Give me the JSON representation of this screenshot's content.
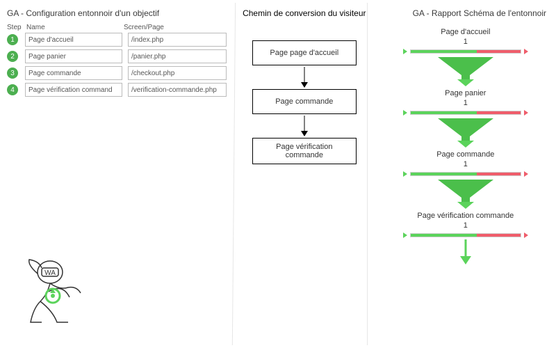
{
  "headings": {
    "left": "GA - Configuration entonnoir d'un objectif",
    "middle": "Chemin de conversion du visiteur",
    "right": "GA - Rapport Schéma de l'entonnoir"
  },
  "config_table": {
    "headers": {
      "step": "Step",
      "name": "Name",
      "page": "Screen/Page"
    },
    "rows": [
      {
        "num": "1",
        "name": "Page d'accueil",
        "page": "/index.php"
      },
      {
        "num": "2",
        "name": "Page panier",
        "page": "/panier.php"
      },
      {
        "num": "3",
        "name": "Page commande",
        "page": "/checkout.php"
      },
      {
        "num": "4",
        "name": "Page vérification command",
        "page": "/verification-commande.php"
      }
    ]
  },
  "visitor_path": [
    "Page page d'accueil",
    "Page commande",
    "Page vérification commande"
  ],
  "funnel_report": [
    {
      "title": "Page d'accueil",
      "count": "1"
    },
    {
      "title": "Page panier",
      "count": "1"
    },
    {
      "title": "Page commande",
      "count": "1"
    },
    {
      "title": "Page vérification commande",
      "count": "1"
    }
  ],
  "mascot_label": "WA",
  "colors": {
    "badge": "#4caf50",
    "bar_green": "#5bd35b",
    "bar_red": "#ef5d6b"
  }
}
